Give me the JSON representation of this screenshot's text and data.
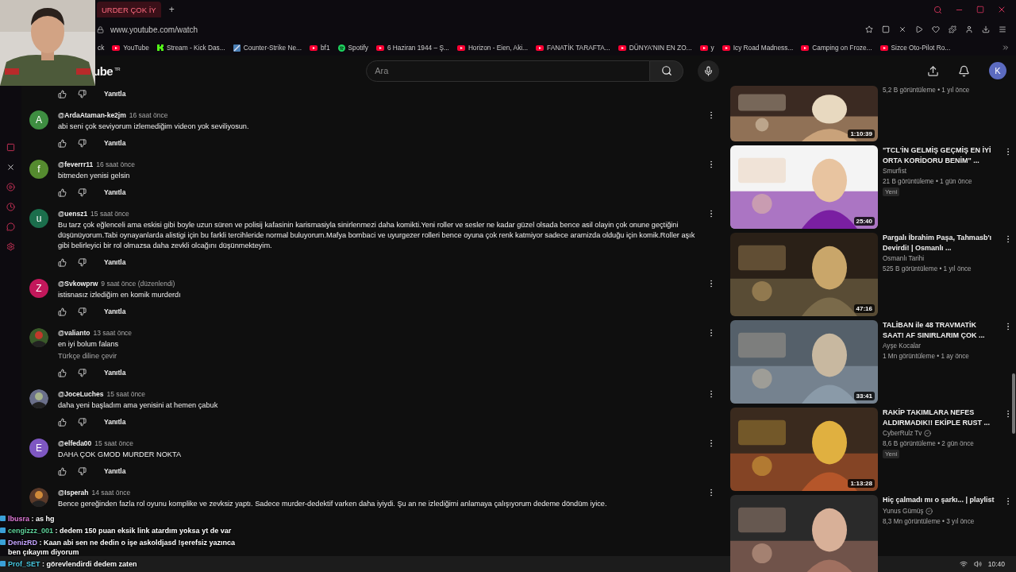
{
  "browser": {
    "tab": {
      "title": "URDER ÇOK İY",
      "selected": true
    },
    "new_tab": "+",
    "url": "www.youtube.com/watch",
    "bookmarks": [
      {
        "kind": "plain",
        "label": "ck"
      },
      {
        "kind": "youtube",
        "label": "YouTube"
      },
      {
        "kind": "kick",
        "label": "Stream - Kick Das..."
      },
      {
        "kind": "game",
        "label": "Counter-Strike Ne..."
      },
      {
        "kind": "youtube",
        "label": "bf1"
      },
      {
        "kind": "spotify",
        "label": "Spotify"
      },
      {
        "kind": "youtube",
        "label": "6 Haziran 1944 – Ş..."
      },
      {
        "kind": "youtube",
        "label": "Horizon - Eien, Aki..."
      },
      {
        "kind": "youtube",
        "label": "FANATİK TARAFTA..."
      },
      {
        "kind": "youtube",
        "label": "DÜNYA'NIN EN ZO..."
      },
      {
        "kind": "youtube",
        "label": "y"
      },
      {
        "kind": "youtube",
        "label": "Icy Road Madness..."
      },
      {
        "kind": "youtube",
        "label": "Camping on Froze..."
      },
      {
        "kind": "youtube",
        "label": "Sizce Oto-Pilot Ro..."
      }
    ]
  },
  "youtube": {
    "logo": "ube",
    "region": "TR",
    "search": {
      "placeholder": "Ara"
    },
    "account": "K"
  },
  "top_reply": "Yanıtla",
  "comments": [
    {
      "author": "@ArdaAtaman-ke2jm",
      "time": "16 saat önce",
      "text": "abi seni çok seviyorum izlemediğim videon yok seviliyosun.",
      "avatar": {
        "kind": "letter",
        "letter": "A",
        "color": "#3e8e41"
      },
      "reply": "Yanıtla"
    },
    {
      "author": "@feverrr11",
      "time": "16 saat önce",
      "text": "bitmeden  yenisi gelsin",
      "avatar": {
        "kind": "letter",
        "letter": "f",
        "color": "#558b2f"
      },
      "reply": "Yanıtla"
    },
    {
      "author": "@uensz1",
      "time": "15 saat önce",
      "text": "Bu tarz çok eğlenceli ama eskisi gibi boyle uzun süren ve polisij kafasinin karismasiyla sinirlenmezi daha komikti.Yeni roller ve sesler ne kadar güzel olsada bence asil olayin çok onune geçtiğini düşünüyorum.Tabi oynayanlarda alistigi için bu farkli tercihleride normal buluyorum.Mafya bombaci  ve uyurgezer rolleri bence oyuna çok renk katmiyor sadece aramizda olduğu için komik.Roller aşık gibi belirleyici bir rol olmazsa daha zevkli olcağını düşünmekteyim.",
      "avatar": {
        "kind": "letter",
        "letter": "u",
        "color": "#1b6e4c"
      },
      "reply": "Yanıtla"
    },
    {
      "author": "@Svkowprw",
      "time": "9 saat önce (düzenlendi)",
      "text": "istisnasız izlediğim en komik murderdı",
      "avatar": {
        "kind": "letter",
        "letter": "Z",
        "color": "#c2185b"
      },
      "reply": "Yanıtla"
    },
    {
      "author": "@valianto",
      "time": "13 saat önce",
      "text": "en iyi bolum falans",
      "translate": "Türkçe diline çevir",
      "reply": "Yanıtla"
    },
    {
      "author": "@JoceLuches",
      "time": "15 saat önce",
      "text": "daha yeni başladım ama yenisini at hemen çabuk",
      "reply": "Yanıtla"
    },
    {
      "author": "@elfeda00",
      "time": "15 saat önce",
      "text": "DAHA ÇOK GMOD MURDER NOKTA",
      "avatar": {
        "kind": "letter",
        "letter": "E",
        "color": "#7e57c2"
      },
      "reply": "Yanıtla"
    },
    {
      "author": "@Isperah",
      "time": "14 saat önce",
      "text": "Bence gereğinden fazla rol oyunu komplike ve zevksiz yaptı. Sadece murder-dedektif varken daha iyiydi. Şu an ne izlediğimi anlamaya çalışıyorum dedeme döndüm iyice."
    }
  ],
  "videos": [
    {
      "kind": "partial",
      "duration": "1:10:39",
      "stats": "5,2 B görüntüleme • 1 yıl önce"
    },
    {
      "kind": "full",
      "title": "\"TCL'İN GELMİŞ GEÇMİŞ EN İYİ ORTA KORİDORU BENİM\" ...",
      "channel": "Smurfist",
      "verified": false,
      "stats": "21 B görüntüleme • 1 gün önce",
      "badge": "Yeni",
      "duration": "25:40"
    },
    {
      "kind": "full",
      "title": "Pargalı İbrahim Paşa, Tahmasb'ı Devirdi! | Osmanlı ...",
      "channel": "Osmanlı Tarihi",
      "verified": false,
      "stats": "525 B görüntüleme • 1 yıl önce",
      "duration": "47:16"
    },
    {
      "kind": "full",
      "title": "TALİBAN ile 48 TRAVMATİK SAAT! AF SINIRLARIM ÇOK ...",
      "channel": "Ayşe Kocalar",
      "verified": false,
      "stats": "1 Mn görüntüleme • 1 ay önce",
      "duration": "33:41"
    },
    {
      "kind": "full",
      "title": "RAKİP TAKIMLARA NEFES ALDIRMADIK!! EKİPLE RUST ...",
      "channel": "CyberRulz Tv",
      "verified": true,
      "stats": "8,6 B görüntüleme • 2 gün önce",
      "badge": "Yeni",
      "duration": "1:13:28"
    },
    {
      "kind": "full",
      "title": "Hiç çalmadı mı o şarkı... | playlist",
      "channel": "Yunus Gümüş",
      "verified": true,
      "stats": "8,3 Mn görüntüleme • 3 yıl önce"
    }
  ],
  "chat": [
    {
      "name": "lbusra",
      "color": "#e07ad8",
      "text": ": as hg"
    },
    {
      "name": "cengizzz_001",
      "color": "#5fd39a",
      "text": ": dedem 150 puan eksik link atardım yoksa yt de var"
    },
    {
      "name": "DenizRD",
      "color": "#c4a3ff",
      "text": ": Kaan abi sen ne dedin o işe askoldjasd !şerefsiz yazınca ben çıkayım diyorum"
    },
    {
      "name": "Prof_SET",
      "color": "#49c8e0",
      "text": ": görevlendirdi dedem zaten"
    }
  ],
  "taskbar": {
    "time": "10:40"
  }
}
